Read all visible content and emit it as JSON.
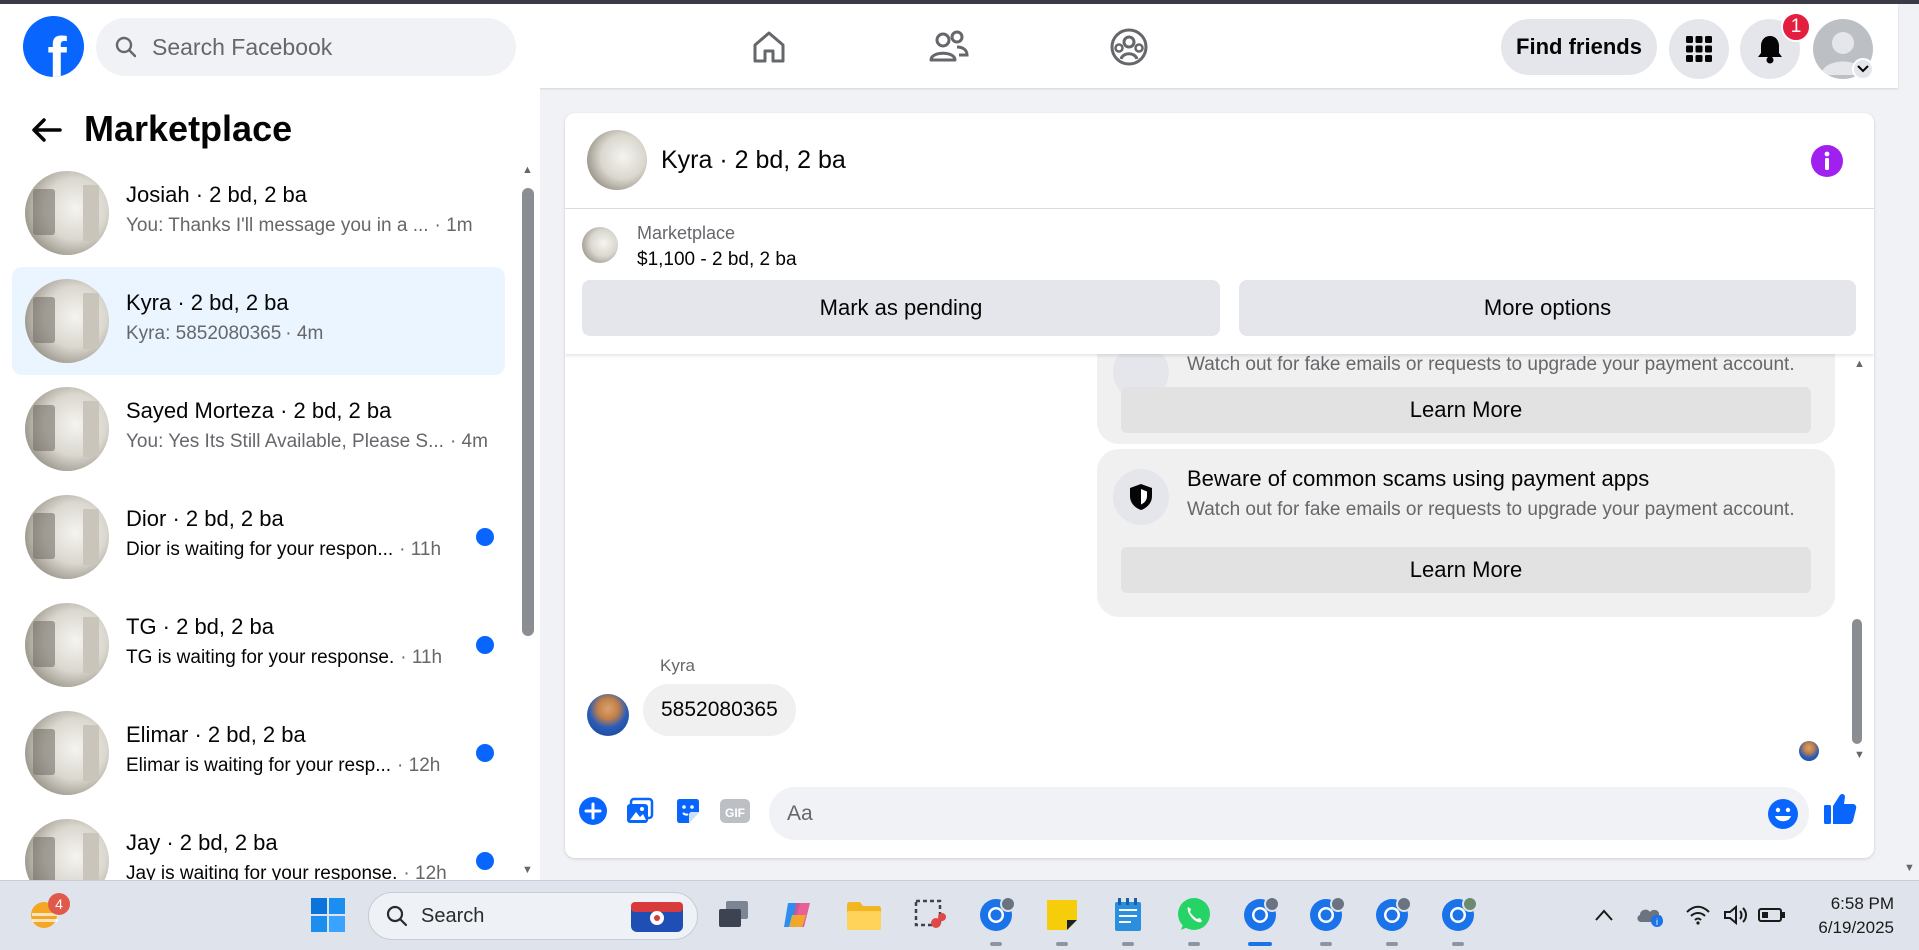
{
  "topbar": {
    "search_placeholder": "Search Facebook",
    "find_friends": "Find friends",
    "notifications_count": "1",
    "icons": [
      "facebook-logo",
      "home-icon",
      "friends-icon",
      "groups-icon",
      "menu-grid-icon",
      "bell-icon",
      "profile-avatar"
    ]
  },
  "sidebar": {
    "title": "Marketplace",
    "conversations": [
      {
        "name": "Josiah · 2 bd, 2 ba",
        "preview": "You: Thanks I'll message you in a ...",
        "time": "· 1m",
        "unread": false
      },
      {
        "name": "Kyra · 2 bd, 2 ba",
        "preview": "Kyra: 5852080365",
        "time": "· 4m",
        "unread": false,
        "active": true
      },
      {
        "name": "Sayed Morteza · 2 bd, 2 ba",
        "preview": "You: Yes Its Still Available, Please S...",
        "time": "· 4m",
        "unread": false
      },
      {
        "name": "Dior · 2 bd, 2 ba",
        "preview": "Dior is waiting for your respon...",
        "time": "· 11h",
        "unread": true
      },
      {
        "name": "TG · 2 bd, 2 ba",
        "preview": "TG is waiting for your response.",
        "time": "· 11h",
        "unread": true
      },
      {
        "name": "Elimar · 2 bd, 2 ba",
        "preview": "Elimar is waiting for your resp...",
        "time": "· 12h",
        "unread": true
      },
      {
        "name": "Jay · 2 bd, 2 ba",
        "preview": "Jay is waiting for your response.",
        "time": "· 12h",
        "unread": true
      }
    ]
  },
  "chat": {
    "title": "Kyra · 2 bd, 2 ba",
    "listing": {
      "label": "Marketplace",
      "price": "$1,100 - 2 bd, 2 ba",
      "mark_pending": "Mark as pending",
      "more_options": "More options"
    },
    "cards": [
      {
        "title": "",
        "text": "Watch out for fake emails or requests to upgrade your payment account.",
        "button": "Learn More"
      },
      {
        "title": "Beware of common scams using payment apps",
        "text": "Watch out for fake emails or requests to upgrade your payment account.",
        "button": "Learn More"
      }
    ],
    "message": {
      "sender": "Kyra",
      "text": "5852080365"
    },
    "composer_placeholder": "Aa"
  },
  "taskbar": {
    "weather_badge": "4",
    "search_label": "Search",
    "time": "6:58 PM",
    "date": "6/19/2025"
  },
  "colors": {
    "brand": "#0866ff",
    "active_conversation": "#ebf5ff",
    "info_purple": "#a020f0"
  }
}
